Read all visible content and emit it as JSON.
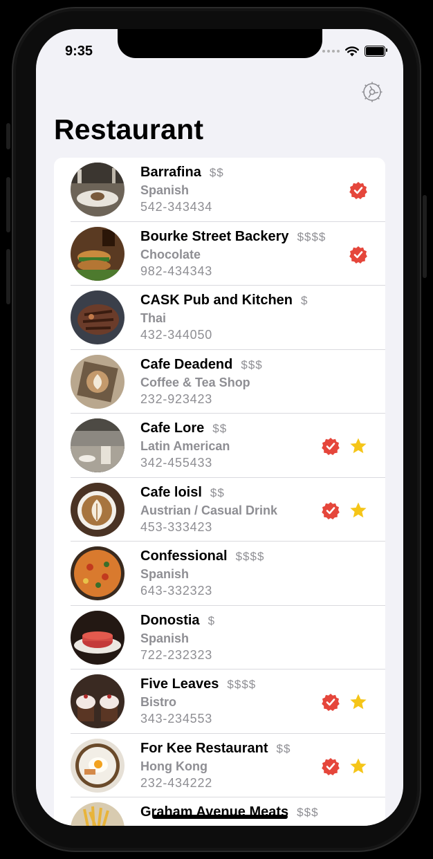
{
  "status": {
    "time": "9:35"
  },
  "header": {
    "title": "Restaurant",
    "settings_icon": "gear-icon"
  },
  "colors": {
    "verified": "#e5463b",
    "favorite": "#f5c518",
    "secondary_text": "#8e8e93"
  },
  "restaurants": [
    {
      "name": "Barrafina",
      "price": "$$",
      "category": "Spanish",
      "phone": "542-343434",
      "verified": true,
      "favorite": false,
      "photo": "restaurant-plate"
    },
    {
      "name": "Bourke Street Backery",
      "price": "$$$$",
      "category": "Chocolate",
      "phone": "982-434343",
      "verified": true,
      "favorite": false,
      "photo": "burger"
    },
    {
      "name": "CASK Pub and Kitchen",
      "price": "$",
      "category": "Thai",
      "phone": "432-344050",
      "verified": false,
      "favorite": false,
      "photo": "ribs"
    },
    {
      "name": "Cafe Deadend",
      "price": "$$$",
      "category": "Coffee & Tea Shop",
      "phone": "232-923423",
      "verified": false,
      "favorite": false,
      "photo": "latte-art"
    },
    {
      "name": "Cafe Lore",
      "price": "$$",
      "category": "Latin American",
      "phone": "342-455433",
      "verified": true,
      "favorite": true,
      "photo": "cafe-table"
    },
    {
      "name": "Cafe loisl",
      "price": "$$",
      "category": "Austrian / Casual Drink",
      "phone": "453-333423",
      "verified": true,
      "favorite": true,
      "photo": "cappuccino"
    },
    {
      "name": "Confessional",
      "price": "$$$$",
      "category": "Spanish",
      "phone": "643-332323",
      "verified": false,
      "favorite": false,
      "photo": "paella"
    },
    {
      "name": "Donostia",
      "price": "$",
      "category": "Spanish",
      "phone": "722-232323",
      "verified": false,
      "favorite": false,
      "photo": "dessert"
    },
    {
      "name": "Five Leaves",
      "price": "$$$$",
      "category": "Bistro",
      "phone": "343-234553",
      "verified": true,
      "favorite": true,
      "photo": "cupcakes"
    },
    {
      "name": "For Kee Restaurant",
      "price": "$$",
      "category": "Hong Kong",
      "phone": "232-434222",
      "verified": true,
      "favorite": true,
      "photo": "egg-plate"
    },
    {
      "name": "Graham Avenue Meats",
      "price": "$$$",
      "category": "",
      "phone": "",
      "verified": false,
      "favorite": false,
      "photo": "fries"
    }
  ]
}
